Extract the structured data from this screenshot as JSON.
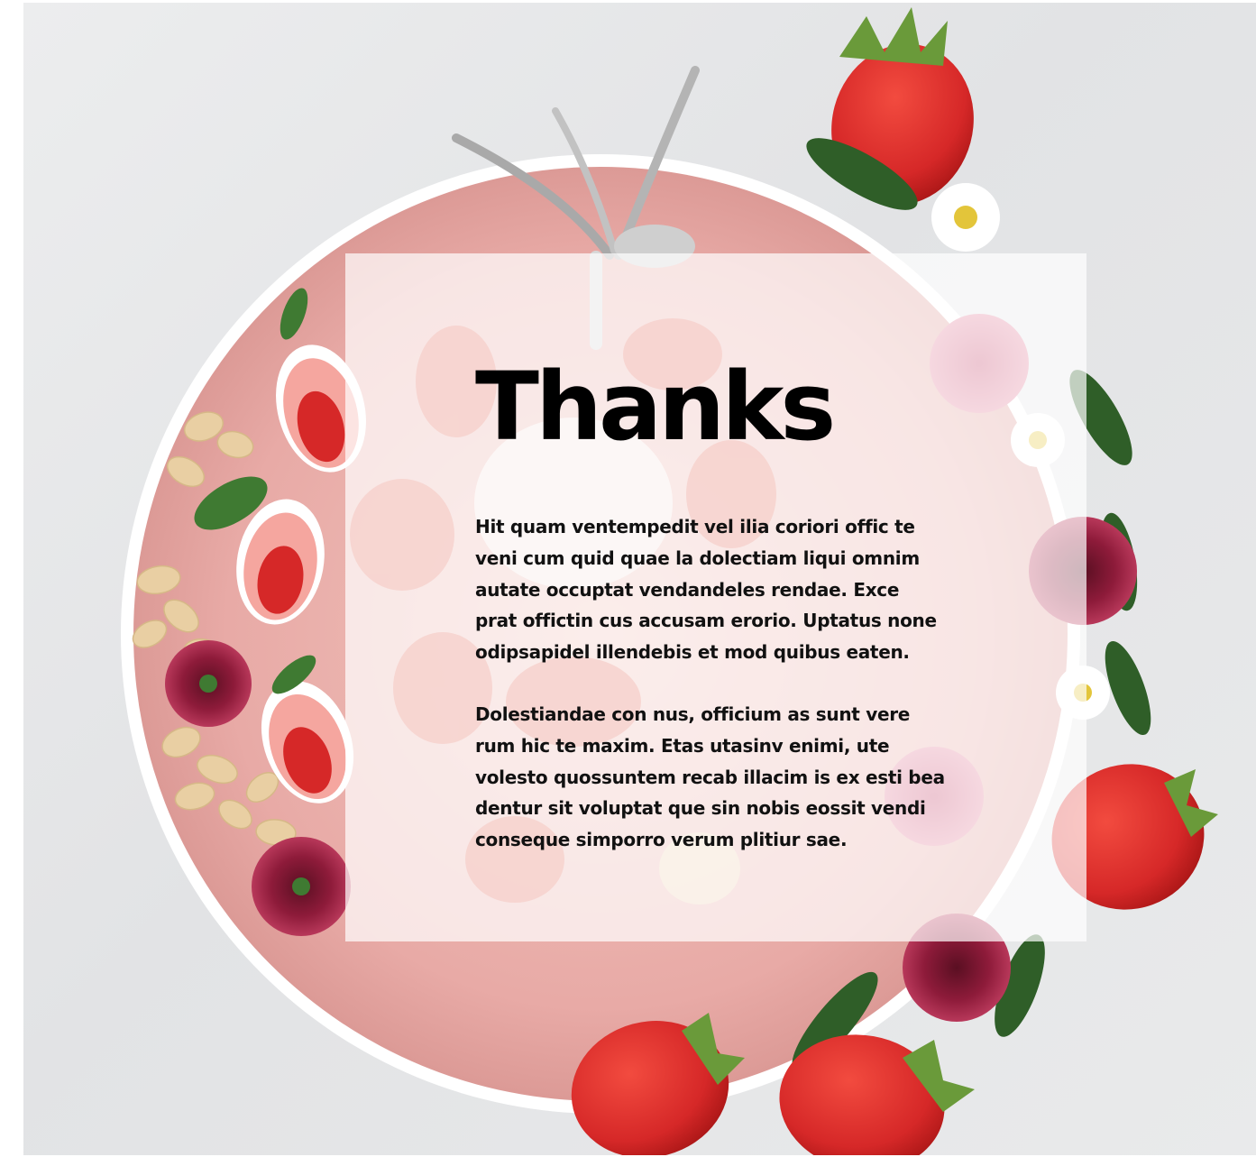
{
  "slide": {
    "title": "Thanks",
    "paragraphs": [
      "Hit quam ventempedit vel ilia coriori offic te\nveni cum quid quae la dolectiam liqui omnim\nautate occuptat vendandeles rendae. Exce\nprat offictin cus accusam erorio. Uptatus none\nodipsapidel illendebis et mod quibus eaten.",
      "Dolestiandae con nus, officium as sunt vere\nrum hic te maxim. Etas utasinv enimi, ute\nvolesto quossuntem recab illacim is ex esti bea\ndentur sit voluptat que sin nobis eossit vendi\nconseque simporro verum plitiur sae."
    ]
  },
  "background": {
    "subject": "smoothie-bowl-with-strawberries-photo",
    "colors": {
      "surface": "#e6e7e9",
      "bowl": "#e8aaa6",
      "strawberry": "#d62828",
      "leaf": "#3f7a32",
      "flower": "#8e1b3a",
      "oat": "#e9cfa3",
      "daisy": "#ffffff"
    }
  },
  "card": {
    "color": "#ffffff",
    "opacity": 0.7
  }
}
